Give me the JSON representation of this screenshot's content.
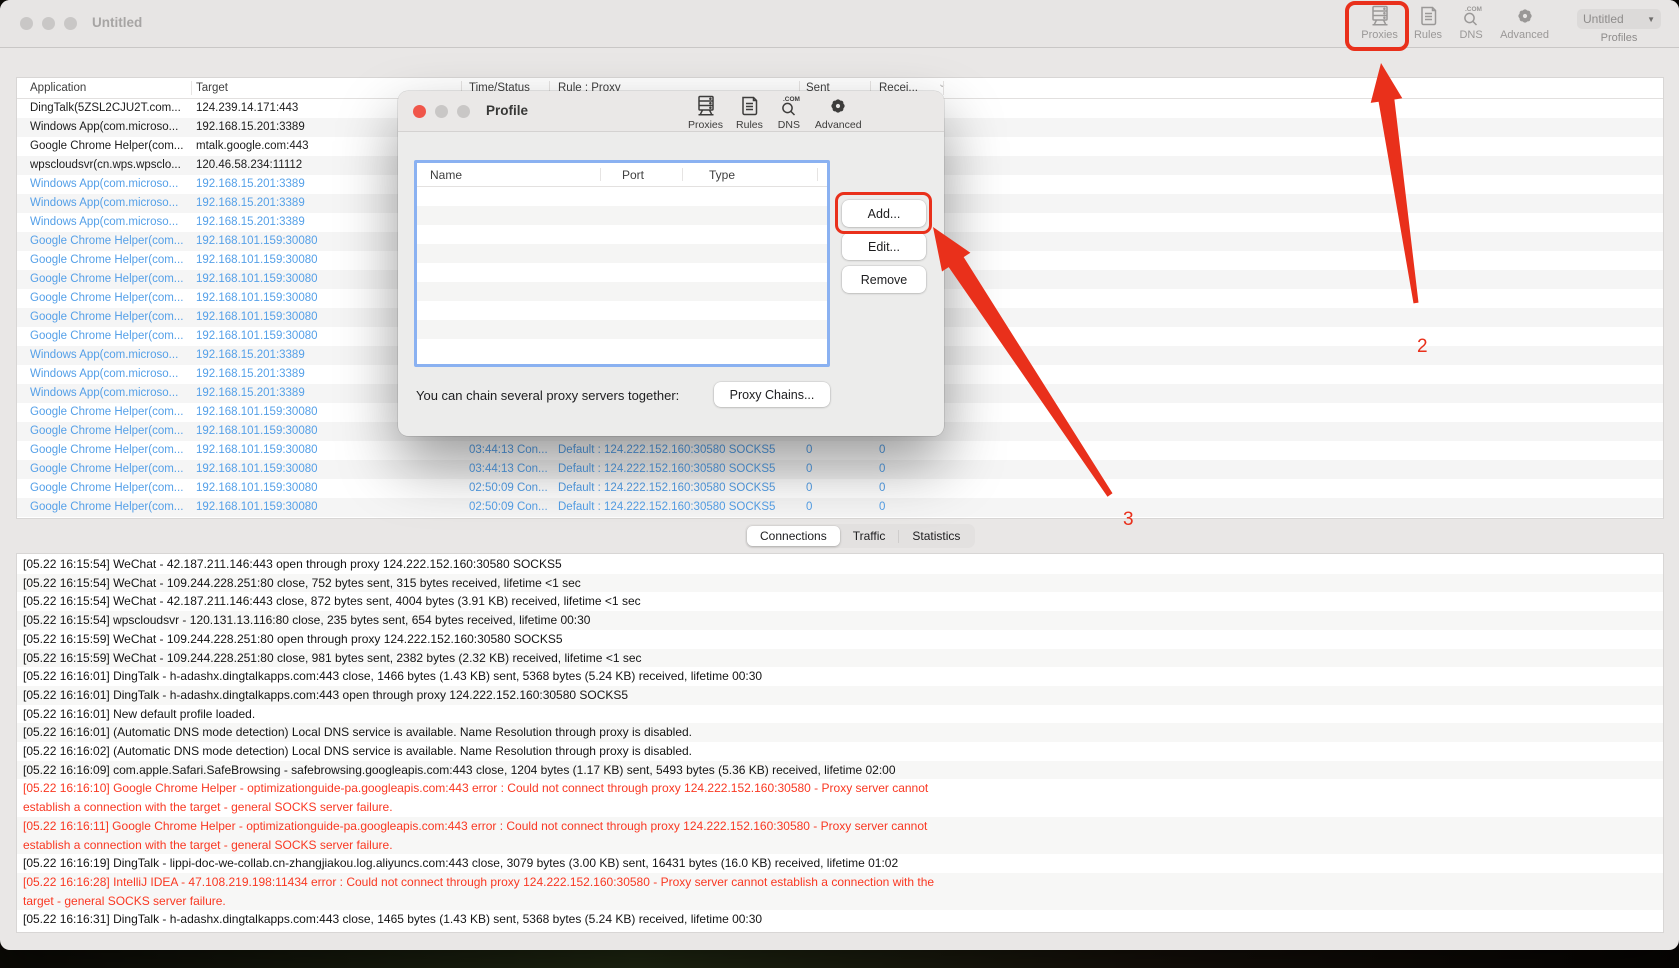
{
  "window": {
    "title": "Untitled"
  },
  "main_toolbar": {
    "items": [
      {
        "label": "Proxies",
        "icon": "proxies-icon"
      },
      {
        "label": "Rules",
        "icon": "rules-icon"
      },
      {
        "label": "DNS",
        "icon": "dns-icon"
      },
      {
        "label": "Advanced",
        "icon": "advanced-icon"
      }
    ],
    "profiles_button": {
      "value": "Untitled"
    },
    "profiles_caption": "Profiles"
  },
  "connections_table": {
    "columns": [
      "Application",
      "Target",
      "Time/Status",
      "Rule : Proxy",
      "Sent",
      "Recei..."
    ],
    "rows": [
      {
        "app": "DingTalk(5ZSL2CJU2T.com...",
        "target": "124.239.14.171:443",
        "blue": false,
        "time": "",
        "rule": "",
        "sent": "",
        "recv": ""
      },
      {
        "app": "Windows App(com.microso...",
        "target": "192.168.15.201:3389",
        "blue": false,
        "time": "",
        "rule": "",
        "sent": "",
        "recv": ""
      },
      {
        "app": "Google Chrome Helper(com...",
        "target": "mtalk.google.com:443",
        "blue": false,
        "time": "",
        "rule": "",
        "sent": "",
        "recv": ""
      },
      {
        "app": "wpscloudsvr(cn.wps.wpsclo...",
        "target": "120.46.58.234:11112",
        "blue": false,
        "time": "",
        "rule": "",
        "sent": "",
        "recv": ""
      },
      {
        "app": "Windows App(com.microso...",
        "target": "192.168.15.201:3389",
        "blue": true,
        "time": "",
        "rule": "",
        "sent": "",
        "recv": ""
      },
      {
        "app": "Windows App(com.microso...",
        "target": "192.168.15.201:3389",
        "blue": true,
        "time": "",
        "rule": "",
        "sent": "",
        "recv": ""
      },
      {
        "app": "Windows App(com.microso...",
        "target": "192.168.15.201:3389",
        "blue": true,
        "time": "",
        "rule": "",
        "sent": "",
        "recv": ""
      },
      {
        "app": "Google Chrome Helper(com...",
        "target": "192.168.101.159:30080",
        "blue": true,
        "time": "",
        "rule": "",
        "sent": "",
        "recv": ""
      },
      {
        "app": "Google Chrome Helper(com...",
        "target": "192.168.101.159:30080",
        "blue": true,
        "time": "",
        "rule": "",
        "sent": "",
        "recv": ""
      },
      {
        "app": "Google Chrome Helper(com...",
        "target": "192.168.101.159:30080",
        "blue": true,
        "time": "",
        "rule": "",
        "sent": "",
        "recv": ""
      },
      {
        "app": "Google Chrome Helper(com...",
        "target": "192.168.101.159:30080",
        "blue": true,
        "time": "",
        "rule": "",
        "sent": "",
        "recv": ""
      },
      {
        "app": "Google Chrome Helper(com...",
        "target": "192.168.101.159:30080",
        "blue": true,
        "time": "",
        "rule": "",
        "sent": "",
        "recv": ""
      },
      {
        "app": "Google Chrome Helper(com...",
        "target": "192.168.101.159:30080",
        "blue": true,
        "time": "",
        "rule": "",
        "sent": "",
        "recv": ""
      },
      {
        "app": "Windows App(com.microso...",
        "target": "192.168.15.201:3389",
        "blue": true,
        "time": "",
        "rule": "",
        "sent": "",
        "recv": ""
      },
      {
        "app": "Windows App(com.microso...",
        "target": "192.168.15.201:3389",
        "blue": true,
        "time": "",
        "rule": "",
        "sent": "",
        "recv": ""
      },
      {
        "app": "Windows App(com.microso...",
        "target": "192.168.15.201:3389",
        "blue": true,
        "time": "",
        "rule": "",
        "sent": "",
        "recv": ""
      },
      {
        "app": "Google Chrome Helper(com...",
        "target": "192.168.101.159:30080",
        "blue": true,
        "time": "",
        "rule": "",
        "sent": "",
        "recv": ""
      },
      {
        "app": "Google Chrome Helper(com...",
        "target": "192.168.101.159:30080",
        "blue": true,
        "time": "",
        "rule": "",
        "sent": "",
        "recv": ""
      },
      {
        "app": "Google Chrome Helper(com...",
        "target": "192.168.101.159:30080",
        "blue": true,
        "time": "03:44:13 Con...",
        "rule": "Default : 124.222.152.160:30580 SOCKS5",
        "sent": "0",
        "recv": "0"
      },
      {
        "app": "Google Chrome Helper(com...",
        "target": "192.168.101.159:30080",
        "blue": true,
        "time": "03:44:13 Con...",
        "rule": "Default : 124.222.152.160:30580 SOCKS5",
        "sent": "0",
        "recv": "0"
      },
      {
        "app": "Google Chrome Helper(com...",
        "target": "192.168.101.159:30080",
        "blue": true,
        "time": "02:50:09 Con...",
        "rule": "Default : 124.222.152.160:30580 SOCKS5",
        "sent": "0",
        "recv": "0"
      },
      {
        "app": "Google Chrome Helper(com...",
        "target": "192.168.101.159:30080",
        "blue": true,
        "time": "02:50:09 Con...",
        "rule": "Default : 124.222.152.160:30580 SOCKS5",
        "sent": "0",
        "recv": "0"
      }
    ]
  },
  "tabs": {
    "items": [
      "Connections",
      "Traffic",
      "Statistics"
    ],
    "selected": "Connections"
  },
  "log": {
    "entries": [
      {
        "text": "[05.22 16:15:54] WeChat - 42.187.211.146:443 open through proxy 124.222.152.160:30580 SOCKS5",
        "error": false
      },
      {
        "text": "[05.22 16:15:54] WeChat - 109.244.228.251:80 close, 752 bytes sent, 315 bytes received, lifetime <1 sec",
        "error": false
      },
      {
        "text": "[05.22 16:15:54] WeChat - 42.187.211.146:443 close, 872 bytes sent, 4004 bytes (3.91 KB) received, lifetime <1 sec",
        "error": false
      },
      {
        "text": "[05.22 16:15:54] wpscloudsvr - 120.131.13.116:80 close, 235 bytes sent, 654 bytes received, lifetime 00:30",
        "error": false
      },
      {
        "text": "[05.22 16:15:59] WeChat - 109.244.228.251:80 open through proxy 124.222.152.160:30580 SOCKS5",
        "error": false
      },
      {
        "text": "[05.22 16:15:59] WeChat - 109.244.228.251:80 close, 981 bytes sent, 2382 bytes (2.32 KB) received, lifetime <1 sec",
        "error": false
      },
      {
        "text": "[05.22 16:16:01] DingTalk - h-adashx.dingtalkapps.com:443 close, 1466 bytes (1.43 KB) sent, 5368 bytes (5.24 KB) received, lifetime 00:30",
        "error": false
      },
      {
        "text": "[05.22 16:16:01] DingTalk - h-adashx.dingtalkapps.com:443 open through proxy 124.222.152.160:30580 SOCKS5",
        "error": false
      },
      {
        "text": "[05.22 16:16:01] New default profile loaded.",
        "error": false
      },
      {
        "text": "[05.22 16:16:01] (Automatic DNS mode detection) Local DNS service is available. Name Resolution through proxy is disabled.",
        "error": false
      },
      {
        "text": "[05.22 16:16:02] (Automatic DNS mode detection) Local DNS service is available. Name Resolution through proxy is disabled.",
        "error": false
      },
      {
        "text": "[05.22 16:16:09] com.apple.Safari.SafeBrowsing - safebrowsing.googleapis.com:443 close, 1204 bytes (1.17 KB) sent, 5493 bytes (5.36 KB) received, lifetime 02:00",
        "error": false
      },
      {
        "text": "[05.22 16:16:10] Google Chrome Helper - optimizationguide-pa.googleapis.com:443 error : Could not connect through proxy 124.222.152.160:30580 - Proxy server cannot",
        "text2": "establish a connection with the target - general SOCKS server failure.",
        "error": true
      },
      {
        "text": "[05.22 16:16:11] Google Chrome Helper - optimizationguide-pa.googleapis.com:443 error : Could not connect through proxy 124.222.152.160:30580 - Proxy server cannot",
        "text2": "establish a connection with the target - general SOCKS server failure.",
        "error": true
      },
      {
        "text": "[05.22 16:16:19] DingTalk - lippi-doc-we-collab.cn-zhangjiakou.log.aliyuncs.com:443 close, 3079 bytes (3.00 KB) sent, 16431 bytes (16.0 KB) received, lifetime 01:02",
        "error": false
      },
      {
        "text": "[05.22 16:16:28] IntelliJ IDEA - 47.108.219.198:11434 error : Could not connect through proxy 124.222.152.160:30580 - Proxy server cannot establish a connection with the",
        "text2": "target - general SOCKS server failure.",
        "error": true
      },
      {
        "text": "[05.22 16:16:31] DingTalk - h-adashx.dingtalkapps.com:443 close, 1465 bytes (1.43 KB) sent, 5368 bytes (5.24 KB) received, lifetime 00:30",
        "error": false
      }
    ]
  },
  "dialog": {
    "title": "Profile",
    "toolbar_items": [
      {
        "label": "Proxies",
        "icon": "proxies-icon"
      },
      {
        "label": "Rules",
        "icon": "rules-icon"
      },
      {
        "label": "DNS",
        "icon": "dns-icon"
      },
      {
        "label": "Advanced",
        "icon": "advanced-icon"
      }
    ],
    "table_columns": [
      "Name",
      "Port",
      "Type"
    ],
    "buttons": {
      "add": "Add...",
      "edit": "Edit...",
      "remove": "Remove"
    },
    "chain_hint": "You can chain several proxy servers together:",
    "chain_button": "Proxy Chains..."
  },
  "annotations": {
    "step2": "2",
    "step3": "3"
  },
  "colors": {
    "annotation_red": "#e9301b",
    "link_blue": "#55a0e8",
    "error_red": "#f93822",
    "focus_ring_blue": "#8ab1f1"
  }
}
